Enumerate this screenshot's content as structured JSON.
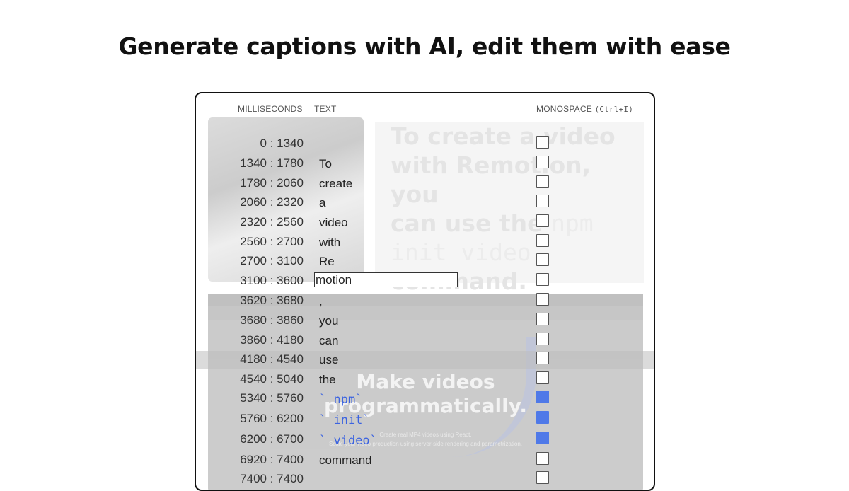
{
  "heading": "Generate captions with AI, edit them with ease",
  "columns": {
    "milliseconds": "MILLISECONDS",
    "text": "TEXT",
    "monospace": "MONOSPACE",
    "shortcut": "(Ctrl+I)"
  },
  "preview": {
    "line1": "To create a video",
    "line2": "with Remotion, you",
    "line3": "can use the ",
    "mono1": "npm",
    "mono2": "init video",
    "line5": "command."
  },
  "browser": {
    "hero_line1": "Make videos",
    "hero_line2": "programmatically.",
    "sub1": "Create real MP4 videos using React.",
    "sub2": "Scale your video production using server-side rendering and parametrization."
  },
  "rows": [
    {
      "ms": "0 : 1340",
      "text": "",
      "mono": false
    },
    {
      "ms": "1340 : 1780",
      "text": "To",
      "mono": false
    },
    {
      "ms": "1780 : 2060",
      "text": "create",
      "mono": false
    },
    {
      "ms": "2060 : 2320",
      "text": "a",
      "mono": false
    },
    {
      "ms": "2320 : 2560",
      "text": "video",
      "mono": false
    },
    {
      "ms": "2560 : 2700",
      "text": "with",
      "mono": false
    },
    {
      "ms": "2700 : 3100",
      "text": "Re",
      "mono": false
    },
    {
      "ms": "3100 : 3600",
      "text": "motion",
      "mono": false,
      "editing": true
    },
    {
      "ms": "3620 : 3680",
      "text": ",",
      "mono": false
    },
    {
      "ms": "3680 : 3860",
      "text": "you",
      "mono": false
    },
    {
      "ms": "3860 : 4180",
      "text": "can",
      "mono": false
    },
    {
      "ms": "4180 : 4540",
      "text": "use",
      "mono": false
    },
    {
      "ms": "4540 : 5040",
      "text": "the",
      "mono": false
    },
    {
      "ms": "5340 : 5760",
      "text": "` npm`",
      "mono": true
    },
    {
      "ms": "5760 : 6200",
      "text": "` init`",
      "mono": true
    },
    {
      "ms": "6200 : 6700",
      "text": "` video`",
      "mono": true
    },
    {
      "ms": "6920 : 7400",
      "text": "command",
      "mono": false
    },
    {
      "ms": "7400 : 7400",
      "text": "",
      "mono": false
    }
  ]
}
